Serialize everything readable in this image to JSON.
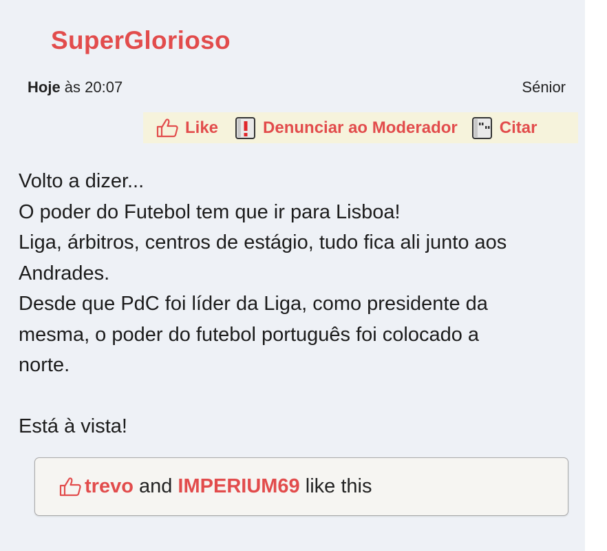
{
  "post": {
    "username": "SuperGlorioso",
    "date_bold": "Hoje",
    "date_rest": " às 20:07",
    "rank": "Sénior"
  },
  "actions": {
    "like_label": "Like",
    "report_label": "Denunciar ao Moderador",
    "quote_label": "Citar",
    "like_icon": "thumbs-up-icon",
    "report_icon": "report-exclamation-icon",
    "quote_icon": "quote-icon"
  },
  "content": {
    "lines": [
      "Volto a dizer...",
      "O poder do Futebol tem que ir para Lisboa!",
      "Liga, árbitros, centros de estágio, tudo fica ali junto aos",
      "Andrades.",
      "Desde que PdC foi líder da Liga, como presidente da",
      "mesma, o poder do futebol português foi colocado a",
      "norte.",
      "",
      "Está à vista!"
    ]
  },
  "likes": {
    "user1": "trevo",
    "joiner": " and ",
    "user2": "IMPERIUM69",
    "suffix": " like this"
  },
  "colors": {
    "accent": "#e24c4c",
    "panel": "#eef1f6",
    "action_bar": "#f6f3dc"
  }
}
